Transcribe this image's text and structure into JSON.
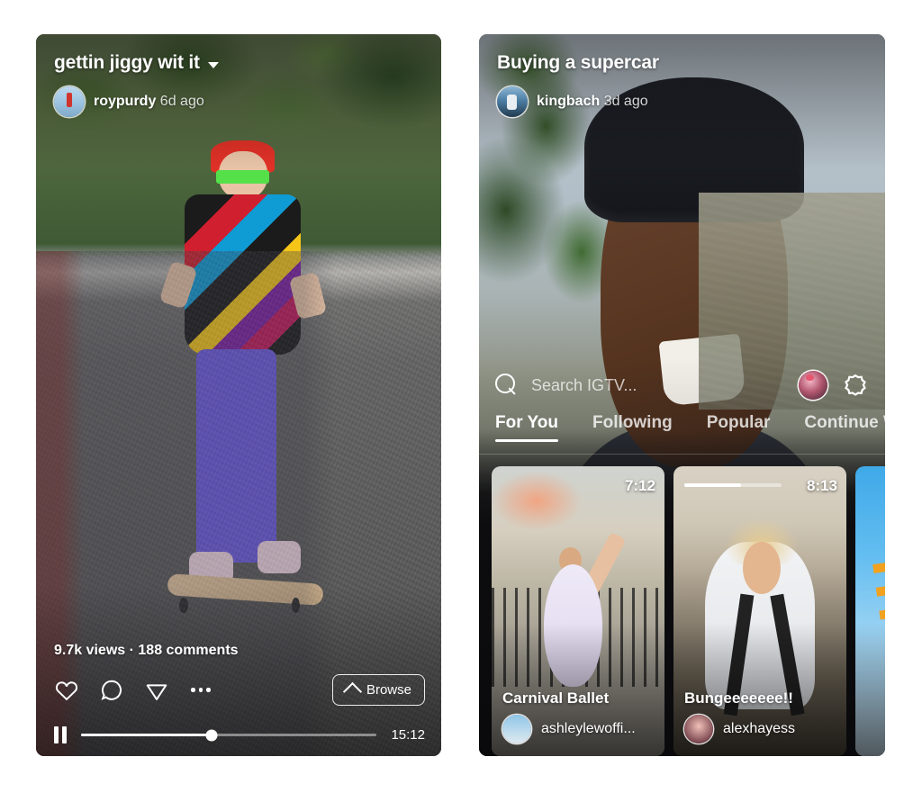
{
  "left_phone": {
    "video_title": "gettin jiggy wit it",
    "title_caret_icon": "chevron-down-icon",
    "author": "roypurdy",
    "timestamp": "6d ago",
    "stats": "9.7k views  ·  188 comments",
    "actions": {
      "like_icon": "heart-icon",
      "comment_icon": "comment-bubble-icon",
      "share_icon": "paper-plane-icon",
      "more_icon": "ellipsis-icon",
      "browse_label": "Browse",
      "browse_chevron_icon": "chevron-up-icon"
    },
    "player": {
      "pause_icon": "pause-icon",
      "progress_percent": 44,
      "duration": "15:12"
    }
  },
  "right_phone": {
    "video_title": "Buying a supercar",
    "author": "kingbach",
    "timestamp": "3d ago",
    "search": {
      "icon": "search-icon",
      "placeholder": "Search IGTV..."
    },
    "header_icons": {
      "avatar": "profile-avatar",
      "igtv_icon": "igtv-settings-icon"
    },
    "tabs": [
      {
        "label": "For You",
        "active": true
      },
      {
        "label": "Following",
        "active": false
      },
      {
        "label": "Popular",
        "active": false
      },
      {
        "label": "Continue W",
        "active": false
      }
    ],
    "cards": [
      {
        "title": "Carnival Ballet",
        "user": "ashleylewoffi...",
        "duration": "7:12",
        "watch_progress_percent": 0
      },
      {
        "title": "Bungeeeeeee!!",
        "user": "alexhayess",
        "duration": "8:13",
        "watch_progress_percent": 58
      },
      {
        "title": "",
        "user": "",
        "duration": "",
        "watch_progress_percent": 0
      }
    ]
  },
  "colors": {
    "page_background": "#ffffff",
    "overlay_text": "#ffffff",
    "sheet_background": "#0d0d0f",
    "accent_white": "#ffffff"
  }
}
